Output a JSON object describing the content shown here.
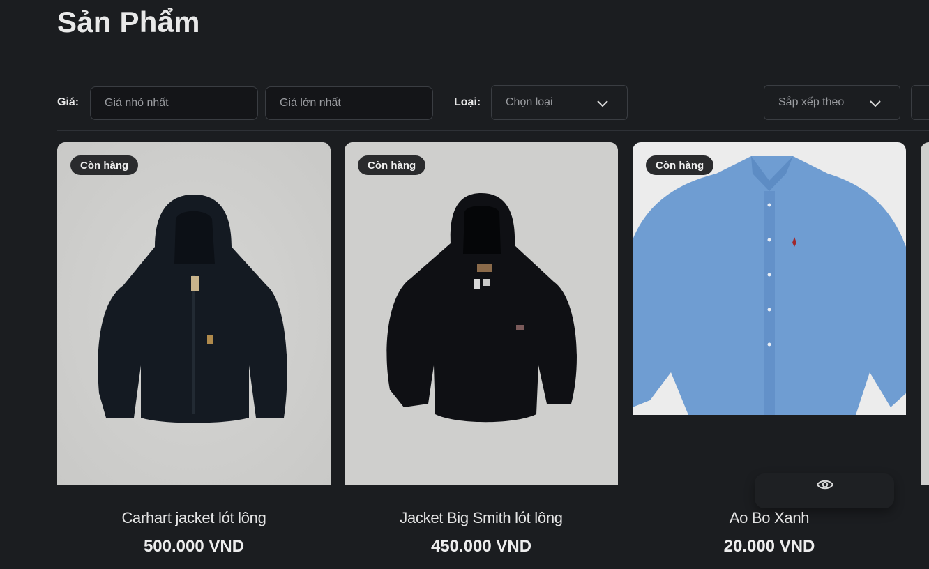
{
  "page": {
    "title": "Sản Phẩm"
  },
  "filters": {
    "price_label": "Giá:",
    "min_price_placeholder": "Giá nhỏ nhất",
    "max_price_placeholder": "Giá lớn nhất",
    "category_label": "Loại:",
    "category_select": "Chọn loại",
    "sort_select": "Sắp xếp theo"
  },
  "products": [
    {
      "badge": "Còn hàng",
      "name": "Carhart jacket lót lông",
      "price": "500.000 VND"
    },
    {
      "badge": "Còn hàng",
      "name": "Jacket Big Smith lót lông",
      "price": "450.000 VND"
    },
    {
      "badge": "Còn hàng",
      "name": "Ao Bo Xanh",
      "price": "20.000 VND"
    }
  ],
  "icons": {
    "chevron": "chevron-down-icon",
    "view": "eye-icon"
  },
  "colors": {
    "background": "#1b1d20",
    "field_border": "#3a3d42",
    "badge_bg": "#2a2b2d",
    "denim": "#6e9bd0"
  }
}
